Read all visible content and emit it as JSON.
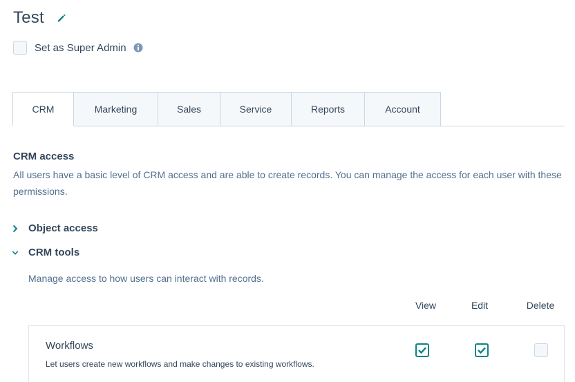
{
  "header": {
    "title": "Test",
    "super_admin_label": "Set as Super Admin",
    "super_admin_checked": false
  },
  "tabs": [
    {
      "label": "CRM",
      "active": true
    },
    {
      "label": "Marketing",
      "active": false
    },
    {
      "label": "Sales",
      "active": false
    },
    {
      "label": "Service",
      "active": false
    },
    {
      "label": "Reports",
      "active": false
    },
    {
      "label": "Account",
      "active": false
    }
  ],
  "crm_access": {
    "title": "CRM access",
    "description": "All users have a basic level of CRM access and are able to create records. You can manage the access for each user with these permissions."
  },
  "sections": {
    "object_access": {
      "label": "Object access",
      "expanded": false
    },
    "crm_tools": {
      "label": "CRM tools",
      "expanded": true,
      "description": "Manage access to how users can interact with records."
    }
  },
  "columns": {
    "view": "View",
    "edit": "Edit",
    "delete": "Delete"
  },
  "permissions": [
    {
      "name": "Workflows",
      "description": "Let users create new workflows and make changes to existing workflows.",
      "view": true,
      "edit": true,
      "delete": false
    }
  ],
  "colors": {
    "accent": "#0b8484",
    "text": "#33475b",
    "border": "#cbd6e2",
    "tab_bg": "#f5f8fa"
  },
  "icons": {
    "edit": "pencil-icon",
    "info": "info-icon",
    "collapsed": "chevron-right-icon",
    "expanded": "chevron-down-icon",
    "checked": "checkmark-icon"
  }
}
